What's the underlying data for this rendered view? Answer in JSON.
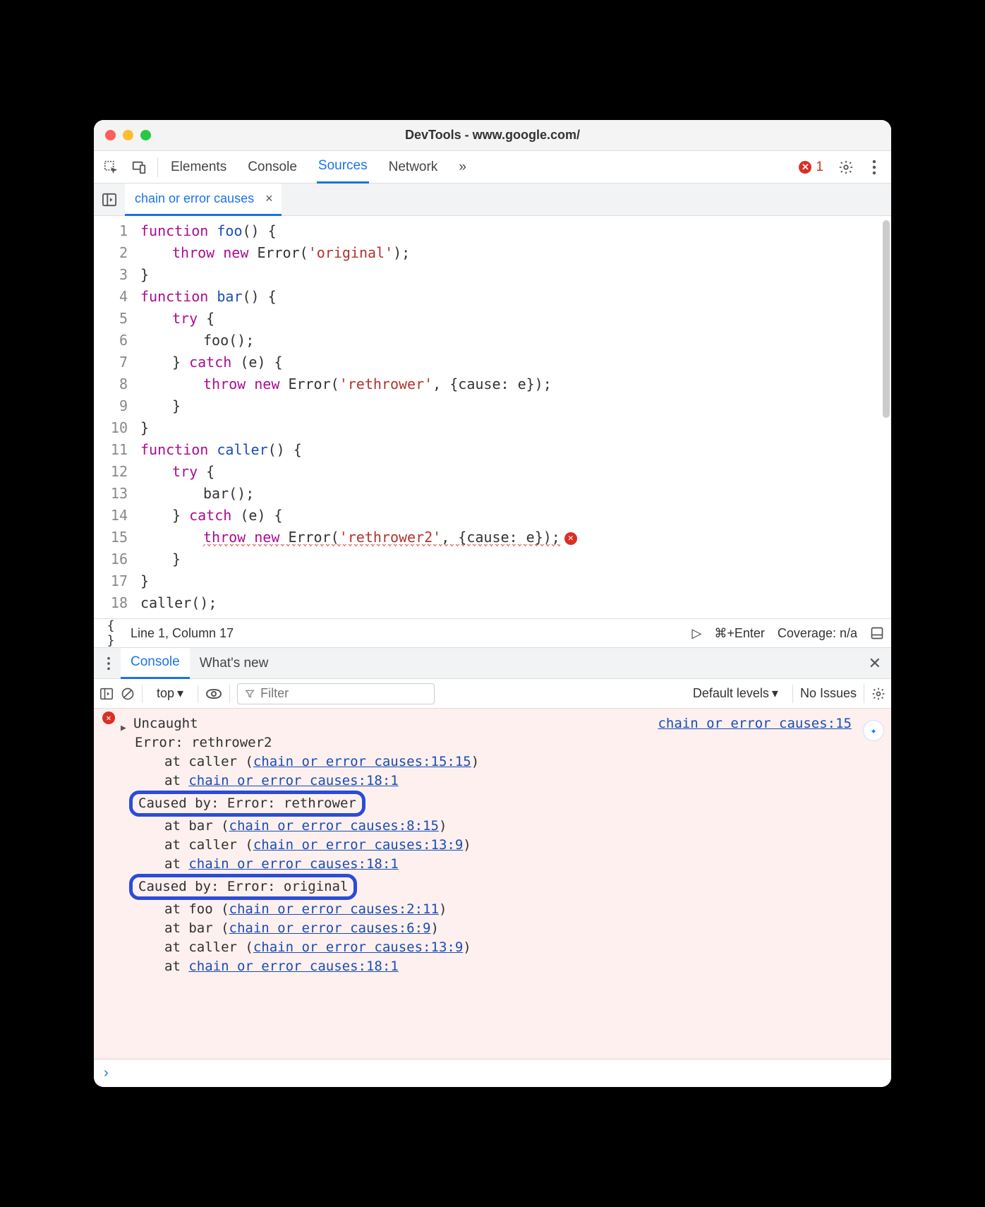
{
  "window": {
    "title": "DevTools - www.google.com/"
  },
  "main_tabs": {
    "items": [
      "Elements",
      "Console",
      "Sources",
      "Network"
    ],
    "active": "Sources",
    "overflow_glyph": "»",
    "error_count": "1"
  },
  "file_tab": {
    "name": "chain or error causes",
    "close_glyph": "×"
  },
  "editor": {
    "line_numbers": [
      "1",
      "2",
      "3",
      "4",
      "5",
      "6",
      "7",
      "8",
      "9",
      "10",
      "11",
      "12",
      "13",
      "14",
      "15",
      "16",
      "17",
      "18"
    ],
    "lines": [
      [
        [
          "k",
          "function"
        ],
        [
          "sp",
          " "
        ],
        [
          "fn",
          "foo"
        ],
        [
          "p",
          "() {"
        ]
      ],
      [
        [
          "ig2"
        ],
        [
          "k",
          "throw"
        ],
        [
          "sp",
          " "
        ],
        [
          "k",
          "new"
        ],
        [
          "sp",
          " "
        ],
        [
          "id",
          "Error"
        ],
        [
          "p",
          "("
        ],
        [
          "s",
          "'original'"
        ],
        [
          "p",
          ");"
        ]
      ],
      [
        [
          "p",
          "}"
        ]
      ],
      [
        [
          "k",
          "function"
        ],
        [
          "sp",
          " "
        ],
        [
          "fn",
          "bar"
        ],
        [
          "p",
          "() {"
        ]
      ],
      [
        [
          "ig2"
        ],
        [
          "k",
          "try"
        ],
        [
          "sp",
          " "
        ],
        [
          "p",
          "{"
        ]
      ],
      [
        [
          "ig3"
        ],
        [
          "id",
          "foo"
        ],
        [
          "p",
          "();"
        ]
      ],
      [
        [
          "ig2"
        ],
        [
          "p",
          "}"
        ],
        [
          "sp",
          " "
        ],
        [
          "k",
          "catch"
        ],
        [
          "sp",
          " "
        ],
        [
          "p",
          "("
        ],
        [
          "id",
          "e"
        ],
        [
          "p",
          ") {"
        ]
      ],
      [
        [
          "ig3"
        ],
        [
          "k",
          "throw"
        ],
        [
          "sp",
          " "
        ],
        [
          "k",
          "new"
        ],
        [
          "sp",
          " "
        ],
        [
          "id",
          "Error"
        ],
        [
          "p",
          "("
        ],
        [
          "s",
          "'rethrower'"
        ],
        [
          "p",
          ", {"
        ],
        [
          "id",
          "cause"
        ],
        [
          "p",
          ": "
        ],
        [
          "id",
          "e"
        ],
        [
          "p",
          "});"
        ]
      ],
      [
        [
          "ig2"
        ],
        [
          "p",
          "}"
        ]
      ],
      [
        [
          "p",
          "}"
        ]
      ],
      [
        [
          "k",
          "function"
        ],
        [
          "sp",
          " "
        ],
        [
          "fn",
          "caller"
        ],
        [
          "p",
          "() {"
        ]
      ],
      [
        [
          "ig2"
        ],
        [
          "k",
          "try"
        ],
        [
          "sp",
          " "
        ],
        [
          "p",
          "{"
        ]
      ],
      [
        [
          "ig3"
        ],
        [
          "id",
          "bar"
        ],
        [
          "p",
          "();"
        ]
      ],
      [
        [
          "ig2"
        ],
        [
          "p",
          "}"
        ],
        [
          "sp",
          " "
        ],
        [
          "k",
          "catch"
        ],
        [
          "sp",
          " "
        ],
        [
          "p",
          "("
        ],
        [
          "id",
          "e"
        ],
        [
          "p",
          ") {"
        ]
      ],
      [
        [
          "ig3"
        ],
        [
          "errline",
          "throw new Error('rethrower2', {cause: e});"
        ]
      ],
      [
        [
          "ig2"
        ],
        [
          "p",
          "}"
        ]
      ],
      [
        [
          "p",
          "}"
        ]
      ],
      [
        [
          "id",
          "caller"
        ],
        [
          "p",
          "();"
        ]
      ]
    ],
    "error_line_index": 14
  },
  "statusbar": {
    "pretty_glyph": "{ }",
    "cursor": "Line 1, Column 17",
    "run_glyph": "▷",
    "shortcut": "⌘+Enter",
    "coverage": "Coverage: n/a"
  },
  "drawer_tabs": {
    "items": [
      "Console",
      "What's new"
    ],
    "active": "Console"
  },
  "console_toolbar": {
    "context": "top",
    "filter_placeholder": "Filter",
    "levels": "Default levels",
    "issues": "No Issues"
  },
  "console": {
    "source_link": "chain or error causes:15",
    "header": "Uncaught",
    "lines": [
      "Error: rethrower2",
      "    at caller (chain or error causes:15:15)",
      "    at chain or error causes:18:1",
      "Caused by: Error: rethrower",
      "    at bar (chain or error causes:8:15)",
      "    at caller (chain or error causes:13:9)",
      "    at chain or error causes:18:1",
      "Caused by: Error: original",
      "    at foo (chain or error causes:2:11)",
      "    at bar (chain or error causes:6:9)",
      "    at caller (chain or error causes:13:9)",
      "    at chain or error causes:18:1"
    ],
    "highlighted_line_indices": [
      3,
      7
    ],
    "links": {
      "2": "chain or error causes:15:15",
      "3": "chain or error causes:18:1",
      "5": "chain or error causes:8:15",
      "6": "chain or error causes:13:9",
      "7": "chain or error causes:18:1",
      "9": "chain or error causes:2:11",
      "10": "chain or error causes:6:9",
      "11": "chain or error causes:13:9",
      "12": "chain or error causes:18:1"
    }
  }
}
